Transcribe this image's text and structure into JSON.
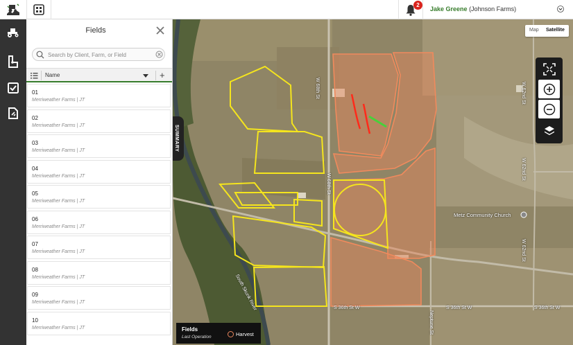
{
  "header": {
    "user_name": "Jake Greene",
    "org": "(Johnson Farms)",
    "notification_count": "2"
  },
  "panel": {
    "title": "Fields",
    "search_placeholder": "Search by Client, Farm, or Field",
    "column_name": "Name",
    "rows": [
      {
        "name": "01",
        "sub": "Merriweather Farms | JT"
      },
      {
        "name": "02",
        "sub": "Merriweather Farms | JT"
      },
      {
        "name": "03",
        "sub": "Merriweather Farms | JT"
      },
      {
        "name": "04",
        "sub": "Merriweather Farms | JT"
      },
      {
        "name": "05",
        "sub": "Merriweather Farms | JT"
      },
      {
        "name": "06",
        "sub": "Merriweather Farms | JT"
      },
      {
        "name": "07",
        "sub": "Merriweather Farms | JT"
      },
      {
        "name": "08",
        "sub": "Merriweather Farms | JT"
      },
      {
        "name": "09",
        "sub": "Merriweather Farms | JT"
      },
      {
        "name": "10",
        "sub": "Merriweather Farms | JT"
      }
    ]
  },
  "map": {
    "summary_tab": "SUMMARY",
    "type_map": "Map",
    "type_satellite": "Satellite",
    "legend_title": "Fields",
    "legend_sub": "Last Operation",
    "legend_item": "Harvest",
    "labels": {
      "w_68th": "W 68th St",
      "w_68th_b": "W 68th St",
      "w_62nd": "W 62nd St",
      "w_62nd_b": "W 62nd St",
      "w_62nd_c": "W 62nd St",
      "s_36th": "S 36th St W",
      "s_36th_b": "S 36th St W",
      "s_36th_c": "S 36th St W",
      "neptune": "Neptune St",
      "church": "Metz Community Church",
      "river": "South Skunk River"
    }
  },
  "colors": {
    "accent": "#367c2b",
    "badge": "#d9231d",
    "harvest": "#e8855c",
    "field_outline": "#f5e51d"
  }
}
